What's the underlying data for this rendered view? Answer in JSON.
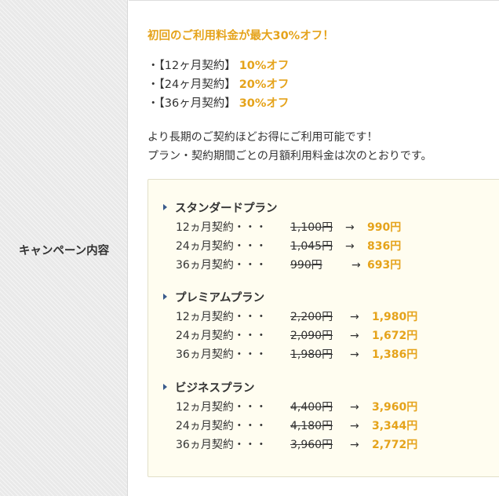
{
  "label": "キャンペーン内容",
  "headline": "初回のご利用料金が最大30%オフ！",
  "bullets": [
    {
      "term": "・【12ヶ月契約】",
      "discount": "10%オフ"
    },
    {
      "term": "・【24ヶ月契約】",
      "discount": "20%オフ"
    },
    {
      "term": "・【36ヶ月契約】",
      "discount": "30%オフ"
    }
  ],
  "paragraph": {
    "line1": "より長期のご契約ほどお得にご利用可能です！",
    "line2": "プラン・契約期間ごとの月額利用料金は次のとおりです。"
  },
  "arrow": "→",
  "plans": [
    {
      "name": "スタンダードプラン",
      "rows": [
        {
          "term": "12ヵ月契約・・・",
          "old": "1,100円",
          "new": "990円"
        },
        {
          "term": "24ヵ月契約・・・",
          "old": "1,045円",
          "new": "836円"
        },
        {
          "term": "36ヵ月契約・・・",
          "old": "990円",
          "new": "693円"
        }
      ]
    },
    {
      "name": "プレミアムプラン",
      "rows": [
        {
          "term": "12ヵ月契約・・・",
          "old": "2,200円",
          "new": "1,980円"
        },
        {
          "term": "24ヵ月契約・・・",
          "old": "2,090円",
          "new": "1,672円"
        },
        {
          "term": "36ヵ月契約・・・",
          "old": "1,980円",
          "new": "1,386円"
        }
      ]
    },
    {
      "name": "ビジネスプラン",
      "rows": [
        {
          "term": "12ヵ月契約・・・",
          "old": "4,400円",
          "new": "3,960円"
        },
        {
          "term": "24ヵ月契約・・・",
          "old": "4,180円",
          "new": "3,344円"
        },
        {
          "term": "36ヵ月契約・・・",
          "old": "3,960円",
          "new": "2,772円"
        }
      ]
    }
  ],
  "colors": {
    "accent": "#e5a31b",
    "bullet_marker": "#3a5b8c",
    "box_bg": "#fffdf0"
  }
}
